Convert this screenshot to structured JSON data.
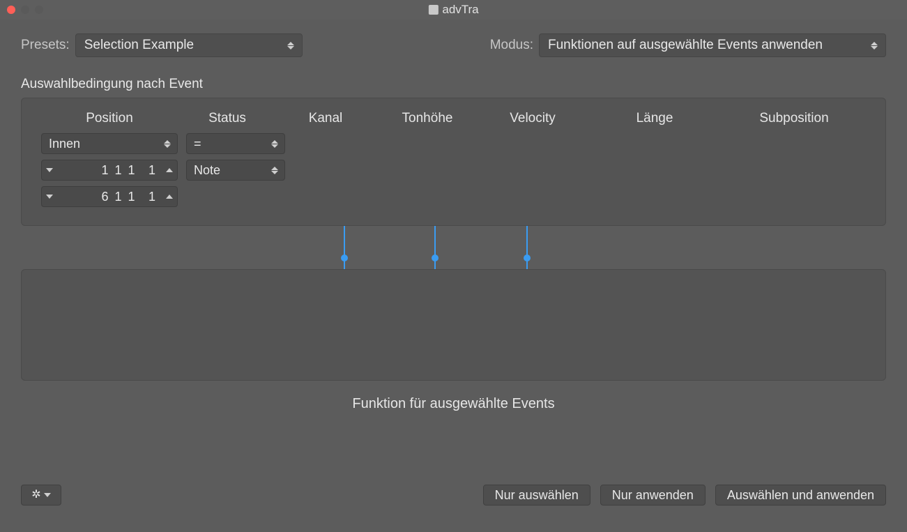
{
  "window": {
    "title": "advTra"
  },
  "top": {
    "presets_label": "Presets:",
    "presets_value": "Selection Example",
    "mode_label": "Modus:",
    "mode_value": "Funktionen auf ausgewählte Events anwenden"
  },
  "condition": {
    "section_label": "Auswahlbedingung nach Event",
    "headers": {
      "position": "Position",
      "status": "Status",
      "kanal": "Kanal",
      "tonhoehe": "Tonhöhe",
      "velocity": "Velocity",
      "laenge": "Länge",
      "subposition": "Subposition"
    },
    "position_mode": "Innen",
    "status_op": "=",
    "status_type": "Note",
    "pos_from_main": "1 1 1",
    "pos_from_sub": "1",
    "pos_to_main": "6 1 1",
    "pos_to_sub": "1"
  },
  "function": {
    "label": "Funktion für ausgewählte Events"
  },
  "buttons": {
    "select_only": "Nur auswählen",
    "apply_only": "Nur anwenden",
    "select_and_apply": "Auswählen und anwenden"
  }
}
